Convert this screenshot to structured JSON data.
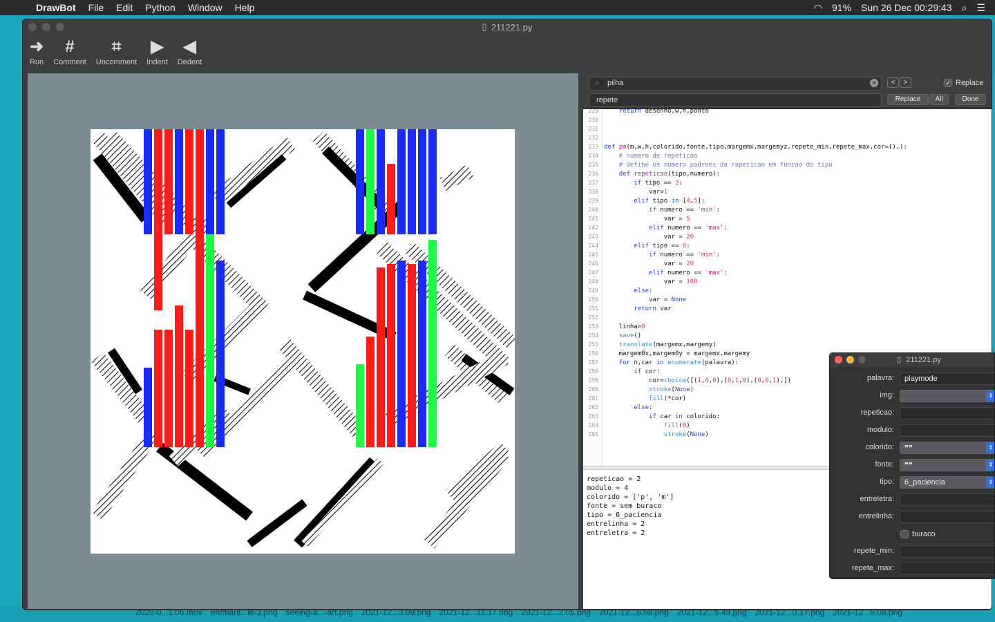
{
  "menubar": {
    "app": "DrawBot",
    "items": [
      "File",
      "Edit",
      "Python",
      "Window",
      "Help"
    ],
    "battery": "91%",
    "clock": "Sun 26 Dec  00:29:43"
  },
  "window": {
    "title": "211221.py",
    "toolbar": [
      {
        "label": "Run",
        "icon": "run-arrow-icon",
        "glyph": "➜"
      },
      {
        "label": "Comment",
        "icon": "hash-icon",
        "glyph": "#"
      },
      {
        "label": "Uncomment",
        "icon": "uncomment-icon",
        "glyph": "⌗"
      },
      {
        "label": "Indent",
        "icon": "indent-icon",
        "glyph": "▶"
      },
      {
        "label": "Dedent",
        "icon": "dedent-icon",
        "glyph": "◀"
      }
    ]
  },
  "find": {
    "search_value": "pilha",
    "replace_value": "repete",
    "replace_checkbox_label": "Replace",
    "replace_btn": "Replace",
    "all_btn": "All",
    "done_btn": "Done"
  },
  "code": [
    {
      "n": "229",
      "t": "    return desenho,w,h,ponto"
    },
    {
      "n": "230",
      "t": ""
    },
    {
      "n": "231",
      "t": ""
    },
    {
      "n": "232",
      "t": ""
    },
    {
      "n": "233",
      "t": "def pm(m,w,h,colorido,fonte,tipo,margemx,margemyz,repete_min,repete_max,cor=(),):"
    },
    {
      "n": "234",
      "t": "    # numero de repeticao"
    },
    {
      "n": "235",
      "t": "    # define os numero padroes da rapeticao em funcao do tipo"
    },
    {
      "n": "236",
      "t": "    def repeticao(tipo,numero):"
    },
    {
      "n": "237",
      "t": "        if tipo == 3:"
    },
    {
      "n": "238",
      "t": "            var=1"
    },
    {
      "n": "239",
      "t": "        elif tipo in [4,5]:"
    },
    {
      "n": "240",
      "t": "            if numero == 'min':"
    },
    {
      "n": "241",
      "t": "                var = 5"
    },
    {
      "n": "242",
      "t": "            elif numero == 'max':"
    },
    {
      "n": "243",
      "t": "                var = 20"
    },
    {
      "n": "244",
      "t": "        elif tipo == 6:"
    },
    {
      "n": "245",
      "t": "            if numero == 'min':"
    },
    {
      "n": "246",
      "t": "                var = 20"
    },
    {
      "n": "247",
      "t": "            elif numero == 'max':"
    },
    {
      "n": "248",
      "t": "                var = 100"
    },
    {
      "n": "249",
      "t": "        else:"
    },
    {
      "n": "250",
      "t": "            var = None"
    },
    {
      "n": "251",
      "t": "        return var"
    },
    {
      "n": "252",
      "t": ""
    },
    {
      "n": "253",
      "t": "    linha=0"
    },
    {
      "n": "254",
      "t": "    save()"
    },
    {
      "n": "255",
      "t": "    translate(margemx,margemy)"
    },
    {
      "n": "256",
      "t": "    margem0x,margem0y = margemx,margemy"
    },
    {
      "n": "257",
      "t": "    for n,car in enumerate(palavra):"
    },
    {
      "n": "258",
      "t": "        if cor:"
    },
    {
      "n": "259",
      "t": "            cor=choice([(1,0,0),(0,1,0),(0,0,1),])"
    },
    {
      "n": "260",
      "t": "            stroke(None)"
    },
    {
      "n": "261",
      "t": "            fill(*cor)"
    },
    {
      "n": "262",
      "t": "        else:"
    },
    {
      "n": "263",
      "t": "            if car in colorido:"
    },
    {
      "n": "264",
      "t": "                fill(0)"
    },
    {
      "n": "265",
      "t": "                stroke(None)"
    }
  ],
  "output": [
    "repeticao = 2",
    "modulo = 4",
    "colorido = ['p', 'm']",
    "fonte = sem buraco",
    "tipo = 6_paciencia",
    "entrelinha = 2",
    "entreletra = 2"
  ],
  "vars_window": {
    "title": "211221.py",
    "rows": [
      {
        "label": "palavra:",
        "value": "playmode",
        "kind": "text"
      },
      {
        "label": "img:",
        "value": "",
        "kind": "select"
      },
      {
        "label": "repeticao:",
        "value": "",
        "kind": "text"
      },
      {
        "label": "modulo:",
        "value": "",
        "kind": "text"
      },
      {
        "label": "colorido:",
        "value": "❞❞",
        "kind": "select"
      },
      {
        "label": "fonte:",
        "value": "❞❞",
        "kind": "select"
      },
      {
        "label": "tipo:",
        "value": "6_paciencia",
        "kind": "select"
      },
      {
        "label": "entreletra:",
        "value": "",
        "kind": "text"
      },
      {
        "label": "entrelinha:",
        "value": "",
        "kind": "text"
      },
      {
        "label": "",
        "value": "buraco",
        "kind": "checkbox"
      },
      {
        "label": "repete_min:",
        "value": "",
        "kind": "text"
      },
      {
        "label": "repete_max:",
        "value": "",
        "kind": "text"
      }
    ]
  },
  "desktop_files": [
    "2020-0...1.06.mov",
    "en/mant...le-3.png",
    "seeing-a...-art.png",
    "2021-12...3.09.png",
    "2021-12...11.17.png",
    "2021-12...2.05.png",
    "2021-12...6.58.png",
    "2021-12...5.49.png",
    "2021-12...0.17.png",
    "2021-12...5.08.png"
  ],
  "colors": {
    "red": "#ff1a1a",
    "green": "#1aff40",
    "blue": "#1a2aff"
  }
}
